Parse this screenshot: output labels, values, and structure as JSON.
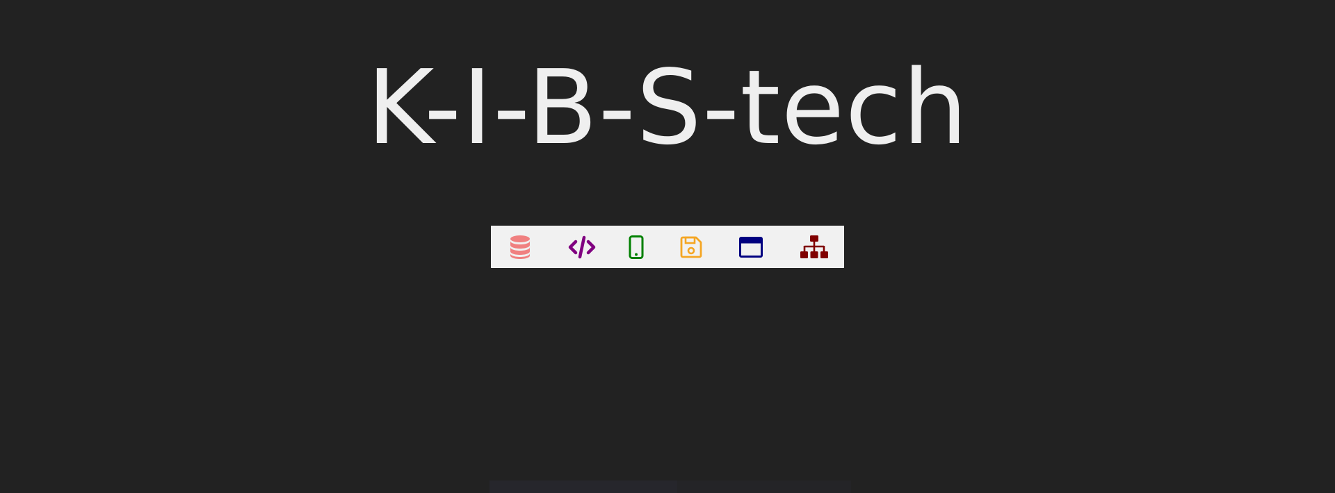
{
  "brand": {
    "title": "K-I-B-S-tech"
  },
  "icon_bar": {
    "icons": [
      {
        "name": "database-icon",
        "color": "#f08080"
      },
      {
        "name": "code-icon",
        "color": "#800080"
      },
      {
        "name": "mobile-phone-icon",
        "color": "#008000"
      },
      {
        "name": "floppy-disk-icon",
        "color": "#f5a623"
      },
      {
        "name": "browser-window-icon",
        "color": "#000080"
      },
      {
        "name": "sitemap-icon",
        "color": "#800000"
      }
    ]
  },
  "colors": {
    "background": "#222222",
    "title_text": "#efefef",
    "icon_bar_background": "#f1f1f1"
  }
}
